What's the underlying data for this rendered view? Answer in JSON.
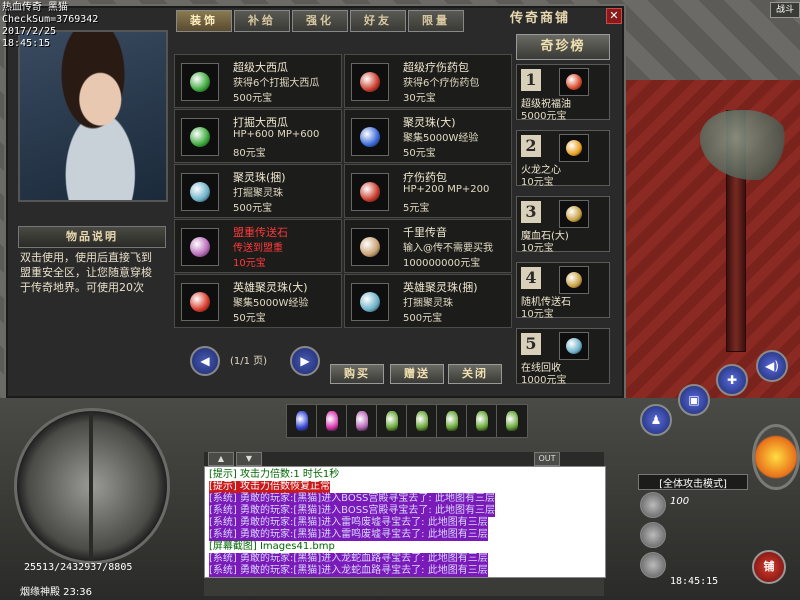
{
  "status": {
    "title": "热血传奇 黑猫",
    "checksum": "CheckSum=3769342",
    "date": "2017/2/25",
    "time": "18:45:15"
  },
  "battle_label": "战斗",
  "shop": {
    "title": "传奇商铺",
    "tabs": [
      "装饰",
      "补给",
      "强化",
      "好友",
      "限量"
    ],
    "desc_title": "物品说明",
    "desc_text": "双击使用，使用后直接飞到盟重安全区，让您随意穿梭于传奇地界。可使用20次",
    "items": [
      {
        "name": "超级大西瓜",
        "d1": "获得6个打掘大西瓜",
        "price": "500元宝",
        "color": "#3aa83a",
        "red": false
      },
      {
        "name": "超级疗伤药包",
        "d1": "获得6个疗伤药包",
        "price": "30元宝",
        "color": "#c83a2a",
        "red": false
      },
      {
        "name": "打掘大西瓜",
        "d1": "HP+600 MP+600",
        "price": "80元宝",
        "color": "#3aa83a",
        "red": false
      },
      {
        "name": "聚灵珠(大)",
        "d1": "聚集5000W经验",
        "price": "50元宝",
        "color": "#3a6ad8",
        "red": false
      },
      {
        "name": "聚灵珠(捆)",
        "d1": "打掘聚灵珠",
        "price": "500元宝",
        "color": "#6ab0c8",
        "red": false
      },
      {
        "name": "疗伤药包",
        "d1": "HP+200 MP+200",
        "price": "5元宝",
        "color": "#c83a2a",
        "red": false
      },
      {
        "name": "盟重传送石",
        "d1": "传送到盟重",
        "price": "10元宝",
        "color": "#b86ab8",
        "red": true
      },
      {
        "name": "千里传音",
        "d1": "输入@传不需要买我",
        "price": "100000000元宝",
        "color": "#c8a070",
        "red": false
      },
      {
        "name": "英雄聚灵珠(大)",
        "d1": "聚集5000W经验",
        "price": "50元宝",
        "color": "#d83a2a",
        "red": false
      },
      {
        "name": "英雄聚灵珠(捆)",
        "d1": "打捆聚灵珠",
        "price": "500元宝",
        "color": "#6ab0c8",
        "red": false
      }
    ],
    "rare_title": "奇珍榜",
    "rare": [
      {
        "num": "1",
        "name": "超级祝福油",
        "price": "5000元宝",
        "color": "#d84a2a"
      },
      {
        "num": "2",
        "name": "火龙之心",
        "price": "10元宝",
        "color": "#e8a020"
      },
      {
        "num": "3",
        "name": "魔血石(大)",
        "price": "10元宝",
        "color": "#c8a040"
      },
      {
        "num": "4",
        "name": "随机传送石",
        "price": "10元宝",
        "color": "#c8a040"
      },
      {
        "num": "5",
        "name": "在线回收",
        "price": "1000元宝",
        "color": "#6ab0c8"
      }
    ],
    "page": "(1/1 页)",
    "buttons": {
      "buy": "购买",
      "gift": "赠送",
      "close": "关闭"
    }
  },
  "hud": {
    "hp": "25513/2432937/8805",
    "map": "烟缘神殿 23:36",
    "attack_mode": "[全体攻击模式]",
    "level": "100",
    "clock": "18:45:15",
    "shop_btn": "铺",
    "chat_out": "OUT",
    "belt_colors": [
      "#3a4ad8",
      "#d83ab0",
      "#b86ab8",
      "#6aa83a",
      "#6aa83a",
      "#6aa83a",
      "#6aa83a",
      "#6aa83a"
    ]
  },
  "chat": [
    {
      "text": "[提示] 攻击力倍数:1 时长1秒",
      "type": "plain"
    },
    {
      "text": "[提示] 攻击力倍数恢复正常",
      "type": "tip"
    },
    {
      "text": "[系统] 勇敢的玩家:[黑猫]进入BOSS宫殿寻宝去了: 此地图有三层",
      "type": "sys"
    },
    {
      "text": "[系统] 勇敢的玩家:[黑猫]进入BOSS宫殿寻宝去了: 此地图有三层",
      "type": "sys"
    },
    {
      "text": "[系统] 勇敢的玩家:[黑猫]进入雷鸣废墟寻宝去了: 此地图有三层",
      "type": "sys"
    },
    {
      "text": "[系统] 勇敢的玩家:[黑猫]进入雷鸣废墟寻宝去了: 此地图有三层",
      "type": "sys"
    },
    {
      "text": "[屏幕截图] Images41.bmp",
      "type": "plain"
    },
    {
      "text": "[系统] 勇敢的玩家:[黑猫]进入龙蛇血路寻宝去了: 此地图有三层",
      "type": "sys"
    },
    {
      "text": "[系统] 勇敢的玩家:[黑猫]进入龙蛇血路寻宝去了: 此地图有三层",
      "type": "sys"
    }
  ]
}
